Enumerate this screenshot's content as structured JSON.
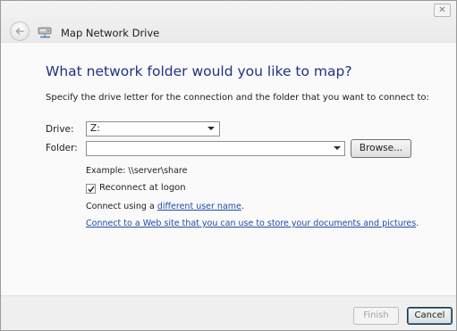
{
  "window": {
    "close_glyph": "✕",
    "title": "Map Network Drive"
  },
  "header": {
    "back_icon": "back-arrow-icon",
    "wizard_icon": "network-drive-icon"
  },
  "main": {
    "heading": "What network folder would you like to map?",
    "instructions": "Specify the drive letter for the connection and the folder that you want to connect to:",
    "drive": {
      "label": "Drive:",
      "value": "Z:"
    },
    "folder": {
      "label": "Folder:",
      "value": "",
      "placeholder": ""
    },
    "browse_label": "Browse...",
    "example": "Example: \\\\server\\share",
    "reconnect": {
      "label": "Reconnect at logon",
      "checked": true
    },
    "connect_prefix": "Connect using a ",
    "connect_link": "different user name",
    "connect_suffix": ".",
    "web_link": "Connect to a Web site that you can use to store your documents and pictures",
    "web_link_suffix": "."
  },
  "footer": {
    "finish_label": "Finish",
    "cancel_label": "Cancel"
  },
  "colors": {
    "heading": "#1e3287",
    "link": "#1f4da6",
    "disabled_text": "#a3a3a3"
  }
}
